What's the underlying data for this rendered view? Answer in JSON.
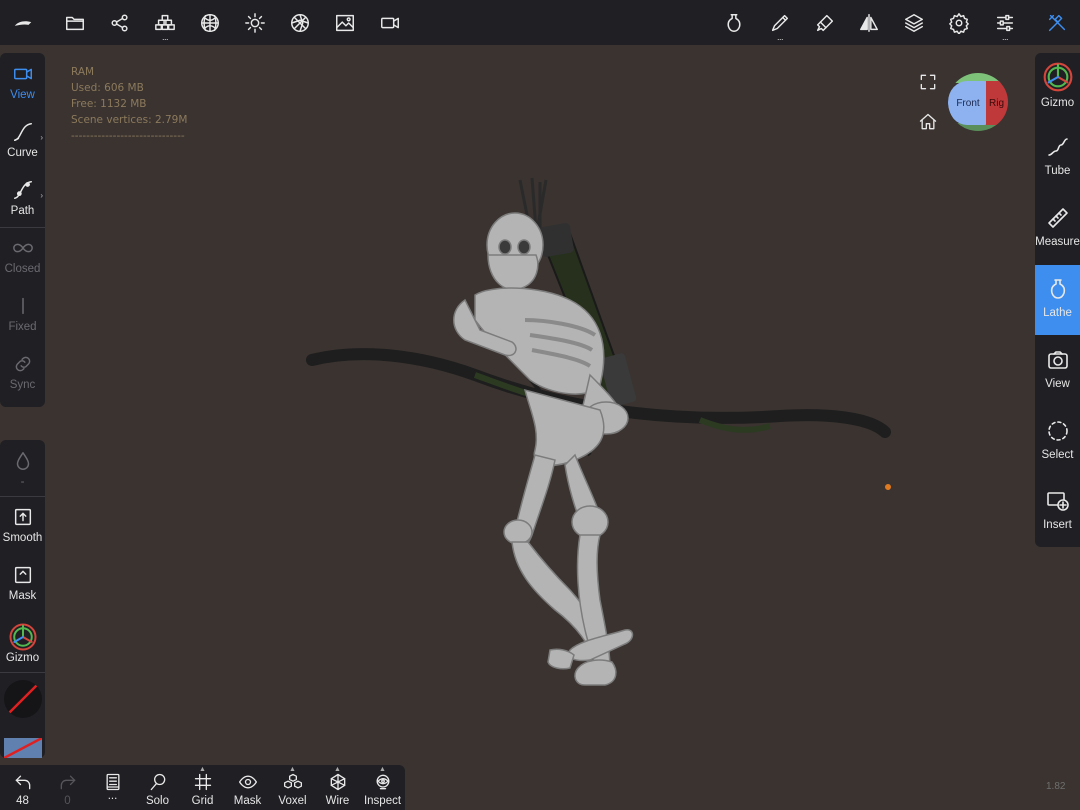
{
  "topbar": {
    "left_tools": [
      {
        "icon": "nomad-logo-icon"
      },
      {
        "icon": "folder-icon"
      },
      {
        "icon": "scene-graph-icon"
      },
      {
        "icon": "stack-bricks-icon",
        "more": "..."
      },
      {
        "icon": "sphere-mesh-icon"
      },
      {
        "icon": "light-sun-icon"
      },
      {
        "icon": "material-ball-icon"
      },
      {
        "icon": "image-icon"
      },
      {
        "icon": "video-camera-icon"
      }
    ],
    "right_tools": [
      {
        "icon": "lathe-vase-icon"
      },
      {
        "icon": "brush-pen-icon",
        "more": "..."
      },
      {
        "icon": "paint-brush-icon"
      },
      {
        "icon": "symmetry-icon"
      },
      {
        "icon": "layers-icon"
      },
      {
        "icon": "settings-gear-icon"
      },
      {
        "icon": "sliders-icon",
        "more": "..."
      },
      {
        "icon": "tools-icon",
        "color": "#3e8ef0"
      }
    ]
  },
  "left_panel": {
    "items": [
      {
        "label": "View",
        "icon": "camera-view-icon",
        "active": true
      },
      {
        "label": "Curve",
        "icon": "curve-icon"
      },
      {
        "label": "Path",
        "icon": "path-icon"
      },
      {
        "label": "Closed",
        "icon": "infinity-icon",
        "disabled": true
      },
      {
        "label": "Fixed",
        "icon": "fixed-line-icon",
        "disabled": true
      },
      {
        "label": "Sync",
        "icon": "link-icon",
        "disabled": true
      }
    ]
  },
  "left_panel_lower": {
    "items": [
      {
        "label": "-",
        "icon": "drop-icon",
        "disabled": true
      },
      {
        "label": "Smooth",
        "icon": "smooth-icon"
      },
      {
        "label": "Mask",
        "icon": "mask-icon"
      },
      {
        "label": "Gizmo",
        "icon": "gizmo-icon"
      }
    ]
  },
  "right_panel": {
    "items": [
      {
        "label": "Gizmo",
        "icon": "gizmo-icon"
      },
      {
        "label": "Tube",
        "icon": "tube-icon"
      },
      {
        "label": "Measure",
        "icon": "ruler-icon"
      },
      {
        "label": "Lathe",
        "icon": "lathe-vase-icon",
        "selected": true
      },
      {
        "label": "View",
        "icon": "camera-icon"
      },
      {
        "label": "Select",
        "icon": "select-circle-icon"
      },
      {
        "label": "Insert",
        "icon": "insert-icon"
      }
    ]
  },
  "bottombar": {
    "items": [
      {
        "label": "48",
        "icon": "undo-icon"
      },
      {
        "label": "0",
        "icon": "redo-icon",
        "disabled": true
      },
      {
        "label": "...",
        "icon": "history-book-icon"
      },
      {
        "label": "Solo",
        "icon": "solo-search-icon"
      },
      {
        "label": "Grid",
        "icon": "grid-icon"
      },
      {
        "label": "Mask",
        "icon": "eye-icon"
      },
      {
        "label": "Voxel",
        "icon": "voxel-icon"
      },
      {
        "label": "Wire",
        "icon": "wire-icon"
      },
      {
        "label": "Inspect",
        "icon": "inspect-icon"
      }
    ]
  },
  "stats": {
    "line1": "RAM",
    "line2": "Used: 606 MB",
    "line3": "Free: 1132 MB",
    "line4": "Scene vertices: 2.79M",
    "line5": "------------------------------"
  },
  "view_cube": {
    "front": "Front",
    "right": "Rig"
  },
  "version": "1.82",
  "colors": {
    "accent": "#3e8ef0",
    "panel": "#1f1f24",
    "background": "#3a3330"
  }
}
